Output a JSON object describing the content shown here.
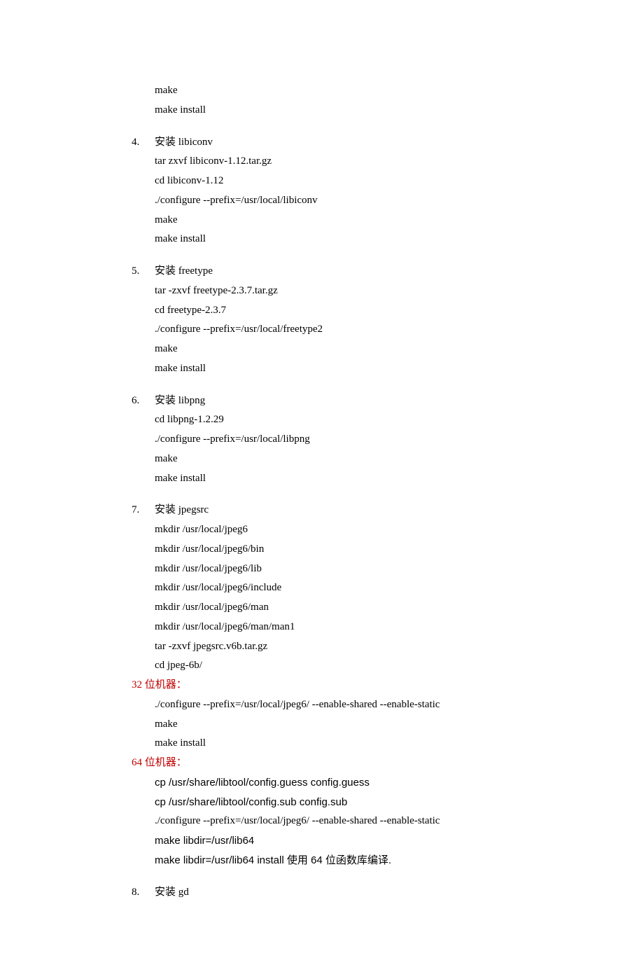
{
  "preItems": [
    "make",
    "make install"
  ],
  "sections": [
    {
      "num": "4.",
      "title": "安装 libiconv",
      "lines": [
        "tar zxvf libiconv-1.12.tar.gz",
        "cd libiconv-1.12",
        "./configure --prefix=/usr/local/libiconv",
        "make",
        "make install"
      ]
    },
    {
      "num": "5.",
      "title": "安装 freetype",
      "lines": [
        "tar -zxvf freetype-2.3.7.tar.gz",
        "cd freetype-2.3.7",
        "./configure --prefix=/usr/local/freetype2",
        "make",
        "make install"
      ]
    },
    {
      "num": "6.",
      "title": "安装 libpng",
      "lines": [
        "cd libpng-1.2.29",
        "./configure --prefix=/usr/local/libpng",
        "make",
        "make install"
      ]
    },
    {
      "num": "7.",
      "title": "安装  jpegsrc",
      "lines": [
        "mkdir /usr/local/jpeg6",
        "mkdir /usr/local/jpeg6/bin",
        "mkdir /usr/local/jpeg6/lib",
        "mkdir /usr/local/jpeg6/include",
        "mkdir /usr/local/jpeg6/man",
        "mkdir /usr/local/jpeg6/man/man1",
        "tar -zxvf jpegsrc.v6b.tar.gz",
        "cd jpeg-6b/"
      ]
    }
  ],
  "label32": "32 位机器：",
  "block32": [
    "./configure --prefix=/usr/local/jpeg6/ --enable-shared --enable-static",
    "make",
    "make install"
  ],
  "label64": "64 位机器：",
  "block64": [
    {
      "text": "cp /usr/share/libtool/config.guess config.guess",
      "arial": true
    },
    {
      "text": "cp /usr/share/libtool/config.sub config.sub",
      "arial": true
    },
    {
      "text": "./configure --prefix=/usr/local/jpeg6/ --enable-shared --enable-static",
      "arial": false
    },
    {
      "text": "make libdir=/usr/lib64",
      "arial": true
    },
    {
      "text": "make libdir=/usr/lib64 install    使用 64 位函数库编译.",
      "arial": true
    }
  ],
  "section8": {
    "num": "8.",
    "title": "安装 gd"
  }
}
